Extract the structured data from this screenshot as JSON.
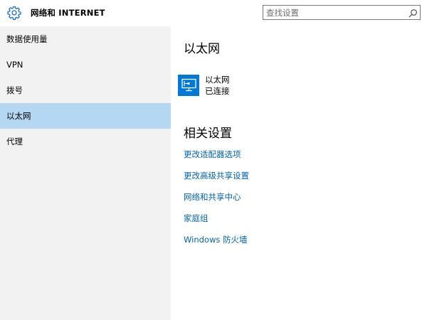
{
  "header": {
    "title": "网络和 INTERNET",
    "search_placeholder": "查找设置",
    "settings_icon": "gear-icon",
    "search_icon": "search-icon"
  },
  "sidebar": {
    "items": [
      {
        "label": "数据使用量",
        "selected": false
      },
      {
        "label": "VPN",
        "selected": false
      },
      {
        "label": "拨号",
        "selected": false
      },
      {
        "label": "以太网",
        "selected": true
      },
      {
        "label": "代理",
        "selected": false
      }
    ]
  },
  "main": {
    "title": "以太网",
    "ethernet": {
      "name": "以太网",
      "status": "已连接",
      "icon": "network-monitor-icon"
    },
    "related": {
      "title": "相关设置",
      "links": [
        "更改适配器选项",
        "更改高级共享设置",
        "网络和共享中心",
        "家庭组",
        "Windows 防火墙"
      ]
    }
  },
  "colors": {
    "accent": "#0078d7",
    "link": "#0063b1",
    "sidebar_bg": "#f2f2f2",
    "selected_bg": "#b4d7f2"
  }
}
